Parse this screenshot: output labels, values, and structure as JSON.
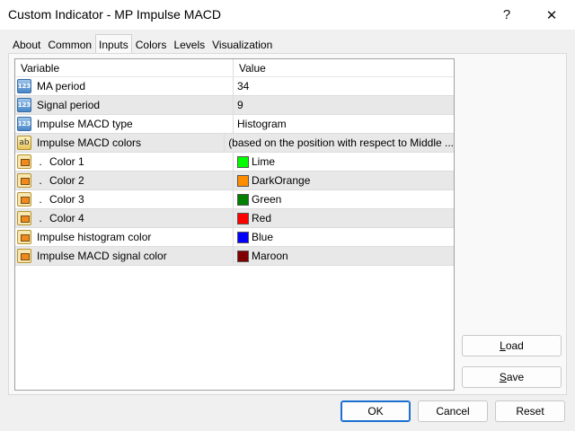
{
  "window": {
    "title": "Custom Indicator - MP Impulse MACD",
    "help_glyph": "?",
    "close_glyph": "✕"
  },
  "tabs": [
    {
      "label": "About"
    },
    {
      "label": "Common"
    },
    {
      "label": "Inputs",
      "active": true
    },
    {
      "label": "Colors"
    },
    {
      "label": "Levels"
    },
    {
      "label": "Visualization"
    }
  ],
  "grid": {
    "headers": {
      "variable": "Variable",
      "value": "Value"
    },
    "rows": [
      {
        "icon": "number-icon",
        "icon_text": "123",
        "variable": "MA period",
        "value": "34"
      },
      {
        "icon": "number-icon",
        "icon_text": "123",
        "variable": "Signal period",
        "value": "9"
      },
      {
        "icon": "number-icon",
        "icon_text": "123",
        "variable": "Impulse MACD type",
        "value": "Histogram"
      },
      {
        "icon": "text-icon",
        "icon_text": "ab",
        "variable": "Impulse MACD colors",
        "value": "(based on the position with respect to Middle ..."
      },
      {
        "icon": "color-icon",
        "prefix": ".",
        "variable": "Color 1",
        "value": "Lime",
        "color": "#00ff00"
      },
      {
        "icon": "color-icon",
        "prefix": ".",
        "variable": "Color 2",
        "value": "DarkOrange",
        "color": "#ff8c00"
      },
      {
        "icon": "color-icon",
        "prefix": ".",
        "variable": "Color 3",
        "value": "Green",
        "color": "#008000"
      },
      {
        "icon": "color-icon",
        "prefix": ".",
        "variable": "Color 4",
        "value": "Red",
        "color": "#ff0000"
      },
      {
        "icon": "color-icon",
        "variable": "Impulse histogram color",
        "value": "Blue",
        "color": "#0000ff"
      },
      {
        "icon": "color-icon",
        "variable": "Impulse MACD signal color",
        "value": "Maroon",
        "color": "#800000"
      }
    ]
  },
  "buttons": {
    "load": {
      "key": "L",
      "rest": "oad"
    },
    "save": {
      "key": "S",
      "rest": "ave"
    },
    "ok": "OK",
    "cancel": "Cancel",
    "reset": "Reset"
  }
}
